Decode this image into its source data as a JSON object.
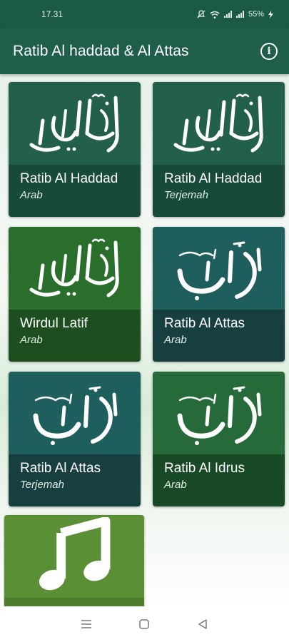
{
  "status_bar": {
    "time": "17.31",
    "battery": "55%"
  },
  "app_bar": {
    "title": "Ratib Al haddad & Al Attas",
    "info_icon": "info-icon"
  },
  "cards": [
    {
      "title": "Ratib Al Haddad",
      "subtitle": "Arab",
      "img_color": "#23604c",
      "text_color": "#184a38",
      "art": "haddad-calligraphy"
    },
    {
      "title": "Ratib Al Haddad",
      "subtitle": "Terjemah",
      "img_color": "#23604c",
      "text_color": "#184a38",
      "art": "haddad-calligraphy"
    },
    {
      "title": "Wirdul Latif",
      "subtitle": "Arab",
      "img_color": "#2a6e2c",
      "text_color": "#1d4e1f",
      "art": "haddad-calligraphy"
    },
    {
      "title": "Ratib Al Attas",
      "subtitle": "Arab",
      "img_color": "#1e5e5c",
      "text_color": "#183f40",
      "art": "attas-calligraphy"
    },
    {
      "title": "Ratib Al Attas",
      "subtitle": "Terjemah",
      "img_color": "#1e5e5c",
      "text_color": "#183f40",
      "art": "attas-calligraphy"
    },
    {
      "title": "Ratib Al Idrus",
      "subtitle": "Arab",
      "img_color": "#256a38",
      "text_color": "#194a26",
      "art": "attas-calligraphy"
    },
    {
      "title": "",
      "subtitle": "",
      "img_color": "#5b8f35",
      "text_color": "#4e7e2d",
      "art": "music-note-icon"
    }
  ],
  "nav_bar": {
    "icons": [
      "menu-icon",
      "home-icon",
      "back-icon"
    ]
  }
}
